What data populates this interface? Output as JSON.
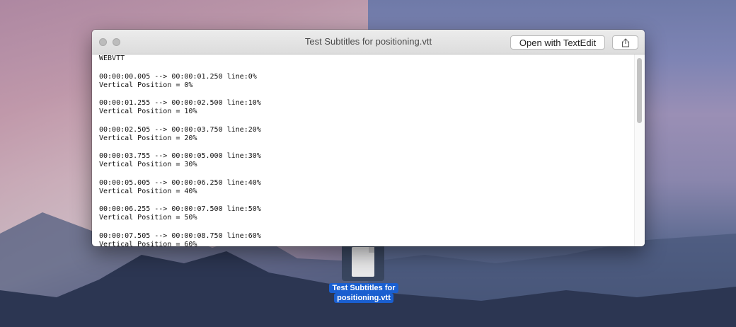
{
  "window": {
    "title": "Test Subtitles for positioning.vtt",
    "open_button": "Open with TextEdit",
    "share_icon": "share-icon"
  },
  "content": {
    "header": "WEBVTT",
    "cues": [
      {
        "timing": "00:00:00.005 --> 00:00:01.250 line:0%",
        "text": "Vertical Position = 0%"
      },
      {
        "timing": "00:00:01.255 --> 00:00:02.500 line:10%",
        "text": "Vertical Position = 10%"
      },
      {
        "timing": "00:00:02.505 --> 00:00:03.750 line:20%",
        "text": "Vertical Position = 20%"
      },
      {
        "timing": "00:00:03.755 --> 00:00:05.000 line:30%",
        "text": "Vertical Position = 30%"
      },
      {
        "timing": "00:00:05.005 --> 00:00:06.250 line:40%",
        "text": "Vertical Position = 40%"
      },
      {
        "timing": "00:00:06.255 --> 00:00:07.500 line:50%",
        "text": "Vertical Position = 50%"
      },
      {
        "timing": "00:00:07.505 --> 00:00:08.750 line:60%",
        "text": "Vertical Position = 60%"
      }
    ]
  },
  "desktop": {
    "file_label_line1": "Test Subtitles for",
    "file_label_line2": "positioning.vtt"
  }
}
